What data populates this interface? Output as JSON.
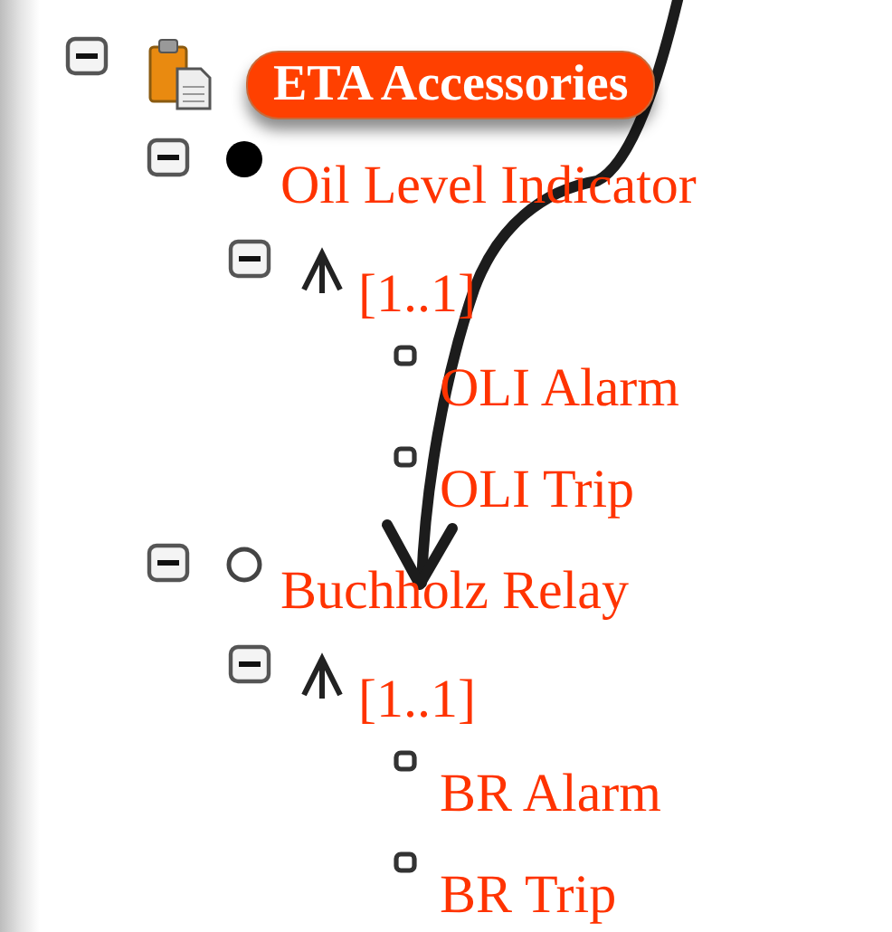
{
  "tree": [
    {
      "kind": "root",
      "label": "ETA Accessories",
      "expanded": true,
      "children": [
        {
          "kind": "option",
          "label": "Oil Level Indicator",
          "selected": true,
          "expanded": true,
          "children": [
            {
              "kind": "group",
              "label": "[1..1]",
              "expanded": true,
              "children": [
                {
                  "kind": "leaf",
                  "label": "OLI Alarm"
                },
                {
                  "kind": "leaf",
                  "label": "OLI Trip"
                }
              ]
            }
          ]
        },
        {
          "kind": "option",
          "label": "Buchholz Relay",
          "selected": false,
          "expanded": true,
          "children": [
            {
              "kind": "group",
              "label": "[1..1]",
              "expanded": true,
              "children": [
                {
                  "kind": "leaf",
                  "label": "BR Alarm"
                },
                {
                  "kind": "leaf",
                  "label": "BR Trip"
                }
              ]
            }
          ]
        }
      ]
    }
  ]
}
